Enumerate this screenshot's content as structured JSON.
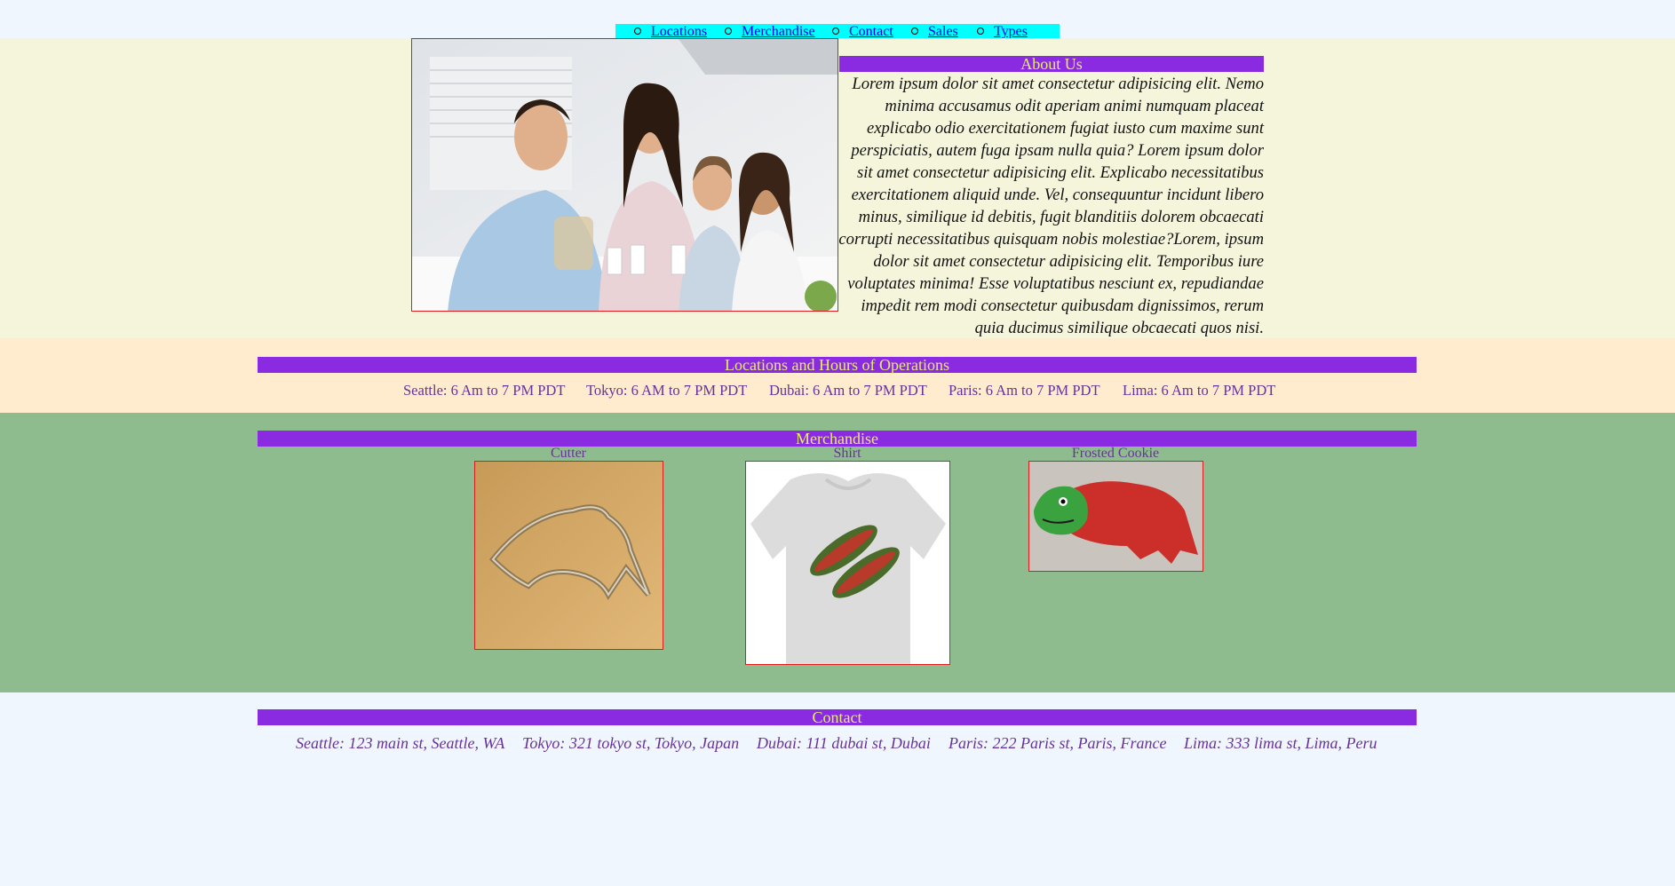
{
  "nav": {
    "items": [
      {
        "label": "Locations"
      },
      {
        "label": "Merchandise"
      },
      {
        "label": "Contact"
      },
      {
        "label": "Sales"
      },
      {
        "label": "Types"
      }
    ]
  },
  "about": {
    "title": "About Us",
    "text": "Lorem ipsum dolor sit amet consectetur adipisicing elit. Nemo minima accusamus odit aperiam animi numquam placeat explicabo odio exercitationem fugiat iusto cum maxime sunt perspiciatis, autem fuga ipsam nulla quia? Lorem ipsum dolor sit amet consectetur adipisicing elit. Explicabo necessitatibus exercitationem aliquid unde. Vel, consequuntur incidunt libero minus, similique id debitis, fugit blanditiis dolorem obcaecati corrupti necessitatibus quisquam nobis molestiae?Lorem, ipsum dolor sit amet consectetur adipisicing elit. Temporibus iure voluptates minima! Esse voluptatibus nesciunt ex, repudiandae impedit rem modi consectetur quibusdam dignissimos, rerum quia ducimus similique obcaecati quos nisi."
  },
  "locations": {
    "title": "Locations and Hours of Operations",
    "items": [
      "Seattle: 6 Am to 7 PM PDT",
      "Tokyo: 6 AM to 7 PM PDT",
      "Dubai: 6 Am to 7 PM PDT",
      "Paris: 6 Am to 7 PM PDT",
      "Lima: 6 Am to 7 PM PDT"
    ]
  },
  "merchandise": {
    "title": "Merchandise",
    "items": [
      {
        "label": "Cutter"
      },
      {
        "label": "Shirt"
      },
      {
        "label": "Frosted Cookie"
      }
    ]
  },
  "contact": {
    "title": "Contact",
    "items": [
      "Seattle: 123 main st, Seattle, WA",
      "Tokyo: 321 tokyo st, Tokyo, Japan",
      "Dubai: 111 dubai st, Dubai",
      "Paris: 222 Paris st, Paris, France",
      "Lima: 333 lima st, Lima, Peru"
    ]
  },
  "colors": {
    "nav_bg": "#00ffff",
    "section_bar": "#8a2be2",
    "section_text": "#e6ec6a",
    "body_text": "#663399",
    "image_border": "#e01b1b"
  }
}
